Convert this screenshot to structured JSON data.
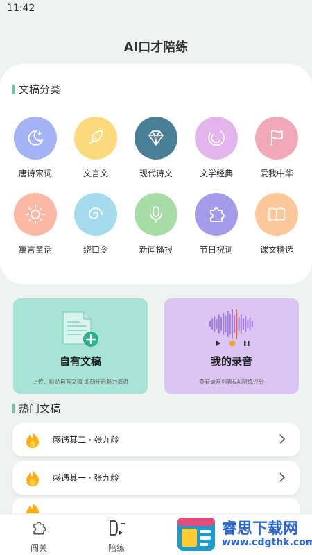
{
  "status_bar": {
    "time": "11:42"
  },
  "app_title": "AI口才陪练",
  "categories_section": {
    "heading": "文稿分类",
    "items": [
      {
        "label": "唐诗宋词",
        "icon": "moon-star-icon",
        "color": "#a4b3f6"
      },
      {
        "label": "文言文",
        "icon": "feather-icon",
        "color": "#fcd97a"
      },
      {
        "label": "现代诗文",
        "icon": "diamond-icon",
        "color": "#4a8097"
      },
      {
        "label": "文学经典",
        "icon": "ring-icon",
        "color": "#e4b5ec"
      },
      {
        "label": "爱我中华",
        "icon": "flag-icon",
        "color": "#f1a9ba"
      },
      {
        "label": "寓言童话",
        "icon": "sun-icon",
        "color": "#fbb9a5"
      },
      {
        "label": "绕口令",
        "icon": "swirl-icon",
        "color": "#a4dcee"
      },
      {
        "label": "新闻播报",
        "icon": "microphone-icon",
        "color": "#a8dca7"
      },
      {
        "label": "节日祝词",
        "icon": "puzzle-icon",
        "color": "#a49cea"
      },
      {
        "label": "课文精选",
        "icon": "book-icon",
        "color": "#fcc89a"
      }
    ]
  },
  "tiles": {
    "own_document": {
      "title": "自有文稿",
      "subtitle": "上传、粘贴自有文稿 即刻开启魅力演讲",
      "color": "#a8e4d6"
    },
    "my_recordings": {
      "title": "我的录音",
      "subtitle": "查看录音列表&AI陪练评分",
      "color": "#dbc5f2"
    }
  },
  "hot_section": {
    "heading": "热门文稿",
    "items": [
      {
        "title": "感遇其二 · 张九龄"
      },
      {
        "title": "感遇其一 · 张九龄"
      }
    ]
  },
  "bottom_nav": {
    "items": [
      {
        "label": "闯关",
        "icon": "puzzle-outline-icon"
      },
      {
        "label": "陪练",
        "icon": "practice-icon"
      }
    ]
  },
  "watermark": {
    "title": "睿思下载网",
    "url": "www.cdgthk.com"
  },
  "colors": {
    "accent": "#6cc7a9",
    "flame": "#ffae1a",
    "brand_blue": "#2a67d6"
  }
}
